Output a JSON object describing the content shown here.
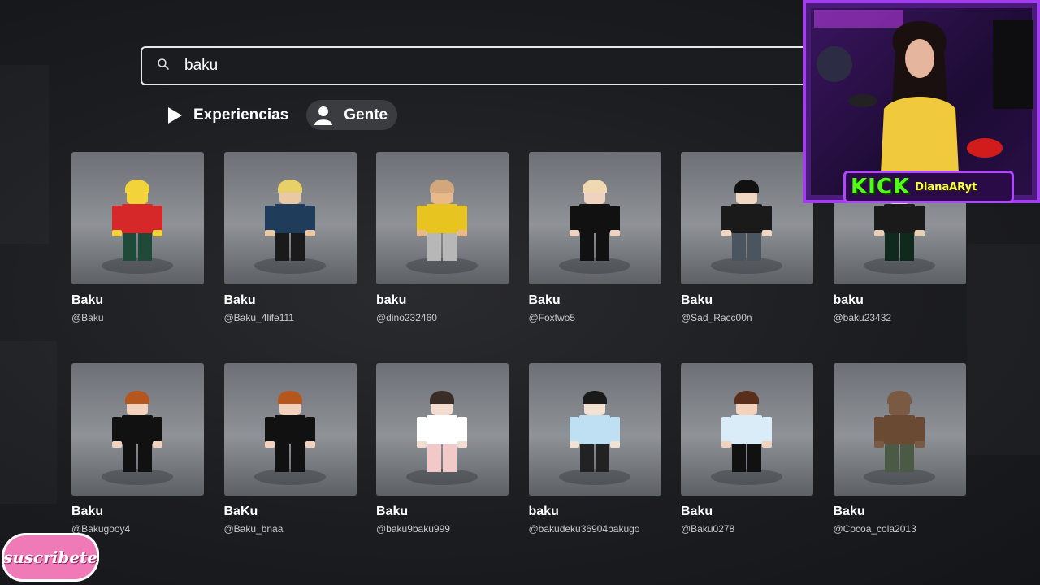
{
  "search": {
    "value": "baku",
    "icon": "search-icon"
  },
  "tabs": [
    {
      "label": "Experiencias",
      "icon": "play-icon",
      "active": false
    },
    {
      "label": "Gente",
      "icon": "person-icon",
      "active": true
    }
  ],
  "results": [
    {
      "name": "Baku",
      "handle": "@Baku",
      "avatar": {
        "skin": "#f2d43a",
        "shirt": "#d62828",
        "legs": "#1f4a3a",
        "hair": "#f2d43a"
      }
    },
    {
      "name": "Baku",
      "handle": "@Baku_4life111",
      "avatar": {
        "skin": "#e8c9a4",
        "shirt": "#1f3d5a",
        "legs": "#1a1a1a",
        "hair": "#e7d067"
      }
    },
    {
      "name": "baku",
      "handle": "@dino232460",
      "avatar": {
        "skin": "#e9b98a",
        "shirt": "#e8c420",
        "legs": "#b7b7b7",
        "hair": "#d2a77c"
      }
    },
    {
      "name": "Baku",
      "handle": "@Foxtwo5",
      "avatar": {
        "skin": "#f0d2c0",
        "shirt": "#111111",
        "legs": "#111111",
        "hair": "#efd9b0"
      }
    },
    {
      "name": "Baku",
      "handle": "@Sad_Racc00n",
      "avatar": {
        "skin": "#f0d7c4",
        "shirt": "#1a1a1a",
        "legs": "#4a5560",
        "hair": "#111111"
      }
    },
    {
      "name": "baku",
      "handle": "@baku23432",
      "avatar": {
        "skin": "#e6cfb5",
        "shirt": "#1a1a1a",
        "legs": "#0f2a1c",
        "hair": "#1a1a1a"
      }
    },
    {
      "name": "Baku",
      "handle": "@Bakugooy4",
      "avatar": {
        "skin": "#f2d2bd",
        "shirt": "#111111",
        "legs": "#111111",
        "hair": "#b5561f"
      }
    },
    {
      "name": "BaKu",
      "handle": "@Baku_bnaa",
      "avatar": {
        "skin": "#f2d2bd",
        "shirt": "#111111",
        "legs": "#111111",
        "hair": "#b5561f"
      }
    },
    {
      "name": "Baku",
      "handle": "@baku9baku999",
      "avatar": {
        "skin": "#f4ddd0",
        "shirt": "#ffffff",
        "legs": "#f2c9c9",
        "hair": "#3a2c26"
      }
    },
    {
      "name": "baku",
      "handle": "@bakudeku36904bakugo",
      "avatar": {
        "skin": "#f2e2d4",
        "shirt": "#bfe0f2",
        "legs": "#222222",
        "hair": "#1a1a1a"
      }
    },
    {
      "name": "Baku",
      "handle": "@Baku0278",
      "avatar": {
        "skin": "#f2d2bd",
        "shirt": "#d9ecf8",
        "legs": "#111111",
        "hair": "#5a2e1a"
      }
    },
    {
      "name": "Baku",
      "handle": "@Cocoa_cola2013",
      "avatar": {
        "skin": "#7a5a42",
        "shirt": "#6b4a33",
        "legs": "#4b5a44",
        "hair": "#7a5a42"
      }
    }
  ],
  "stream_overlay": {
    "platform": "KICK",
    "username": "DianaARyt",
    "subscribe_label": "suscribete"
  },
  "colors": {
    "accent_purple": "#a23ef0",
    "kick_green": "#53fc18",
    "subscribe_pink": "#f07ab8"
  }
}
